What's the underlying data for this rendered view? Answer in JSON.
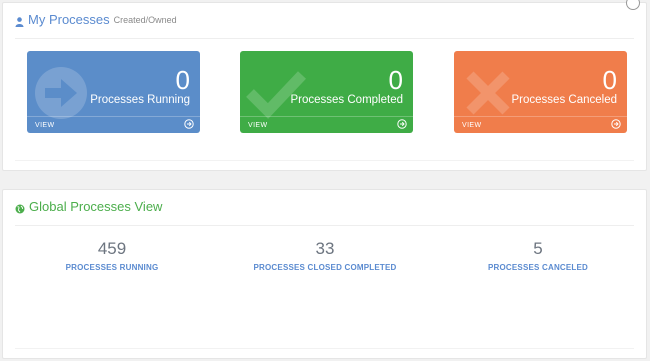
{
  "my_processes": {
    "title": "My Processes",
    "subtitle": "Created/Owned",
    "icon": "user-icon",
    "tiles": [
      {
        "count": "0",
        "label": "Processes Running",
        "view": "VIEW",
        "color": "#5b8dc9",
        "icon": "arrow-circle-icon"
      },
      {
        "count": "0",
        "label": "Processes Completed",
        "view": "VIEW",
        "color": "#3fac46",
        "icon": "check-icon"
      },
      {
        "count": "0",
        "label": "Processes Canceled",
        "view": "VIEW",
        "color": "#f07d4b",
        "icon": "x-icon"
      }
    ]
  },
  "global_processes": {
    "title": "Global Processes View",
    "icon": "globe-icon",
    "stats": [
      {
        "count": "459",
        "label": "PROCESSES RUNNING"
      },
      {
        "count": "33",
        "label": "PROCESSES CLOSED COMPLETED"
      },
      {
        "count": "5",
        "label": "PROCESSES CANCELED"
      }
    ]
  }
}
